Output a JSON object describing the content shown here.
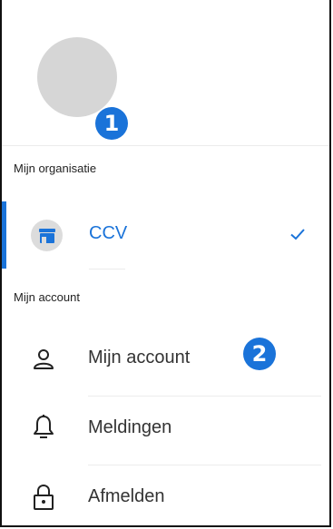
{
  "profile": {
    "avatar": "avatar"
  },
  "callouts": {
    "one": "1",
    "two": "2"
  },
  "organisation": {
    "section_label": "Mijn organisatie",
    "name": "CCV",
    "icon": "store-icon",
    "selected_icon": "check-icon",
    "accent": "#1a73d9"
  },
  "account": {
    "section_label": "Mijn account",
    "items": [
      {
        "label": "Mijn account",
        "icon": "user-icon"
      },
      {
        "label": "Meldingen",
        "icon": "bell-icon"
      },
      {
        "label": "Afmelden",
        "icon": "lock-icon"
      }
    ]
  }
}
